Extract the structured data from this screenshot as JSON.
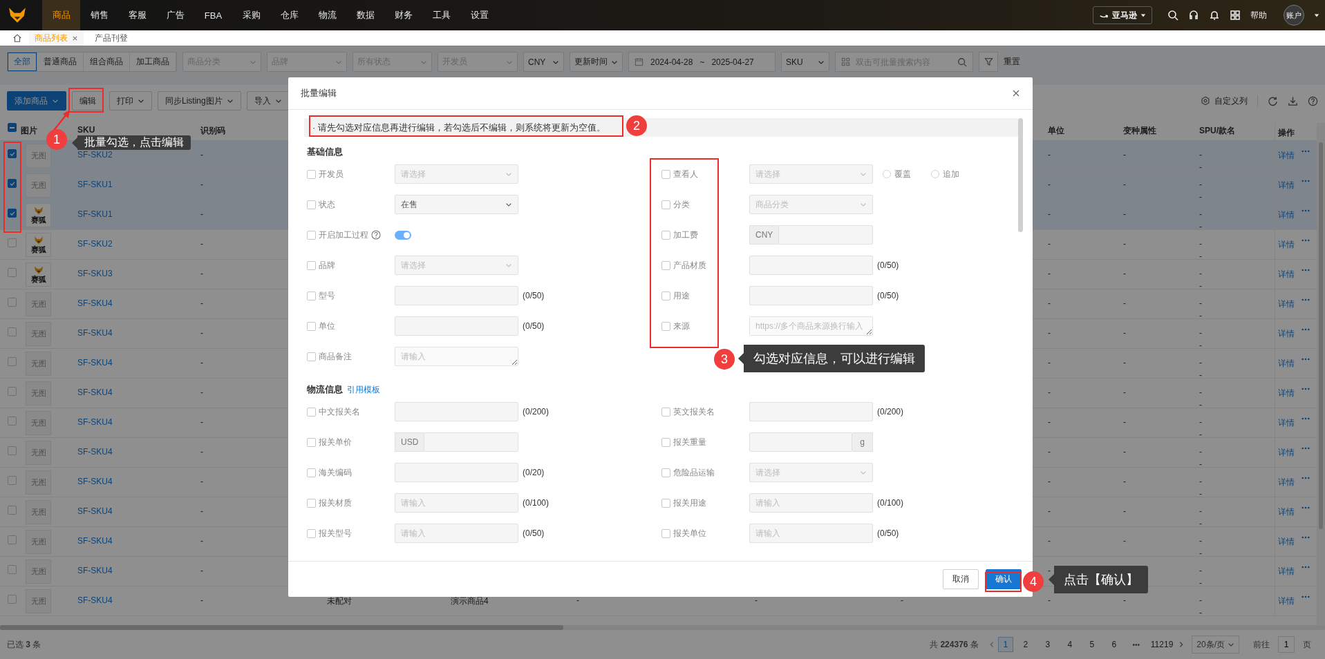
{
  "nav": {
    "items": [
      {
        "label": "商品",
        "selected": true
      },
      {
        "label": "销售",
        "selected": false
      },
      {
        "label": "客服",
        "selected": false
      },
      {
        "label": "广告",
        "selected": false
      },
      {
        "label": "FBA",
        "selected": false
      },
      {
        "label": "采购",
        "selected": false
      },
      {
        "label": "仓库",
        "selected": false
      },
      {
        "label": "物流",
        "selected": false
      },
      {
        "label": "数据",
        "selected": false
      },
      {
        "label": "财务",
        "selected": false
      },
      {
        "label": "工具",
        "selected": false
      },
      {
        "label": "设置",
        "selected": false
      }
    ],
    "platform": "亚马逊",
    "help": "帮助",
    "account": "账户"
  },
  "tabs": [
    {
      "label": "商品列表",
      "selected": true,
      "closable": true
    },
    {
      "label": "产品刊登",
      "selected": false,
      "closable": false
    }
  ],
  "filters": {
    "types": [
      {
        "label": "全部",
        "selected": true
      },
      {
        "label": "普通商品",
        "selected": false
      },
      {
        "label": "组合商品",
        "selected": false
      },
      {
        "label": "加工商品",
        "selected": false
      }
    ],
    "selects": [
      {
        "placeholder": "商品分类"
      },
      {
        "placeholder": "品牌"
      },
      {
        "placeholder": "所有状态"
      },
      {
        "placeholder": "开发员"
      },
      {
        "value": "CNY"
      },
      {
        "value": "更新时间"
      }
    ],
    "date_start": "2024-04-28",
    "date_sep": "~",
    "date_end": "2025-04-27",
    "search_by": "SKU",
    "search_placeholder": "双击可批量搜索内容",
    "reset": "重置"
  },
  "toolbar": {
    "buttons": [
      {
        "label": "添加商品",
        "kind": "primary",
        "caret": true
      },
      {
        "label": "编辑",
        "kind": "default",
        "caret": false
      },
      {
        "label": "打印",
        "kind": "default",
        "caret": true
      },
      {
        "label": "同步Listing图片",
        "kind": "default",
        "caret": true
      },
      {
        "label": "导入",
        "kind": "default",
        "caret": true
      }
    ],
    "columns_button": "自定义列"
  },
  "table": {
    "select_all_partial": true,
    "columns": [
      {
        "label": "图片"
      },
      {
        "label": "SKU"
      },
      {
        "label": "识别码"
      },
      {
        "label": "单位"
      },
      {
        "label": "变种属性"
      },
      {
        "label": "SPU/款名"
      },
      {
        "label": "操作"
      }
    ],
    "rows": [
      {
        "checked": true,
        "image": {
          "kind": "none",
          "text": "无图"
        },
        "sku": "SF-SKU2",
        "code": "-",
        "unit": "-",
        "variant": "-",
        "spu": [
          "-",
          "-"
        ],
        "action": "详情"
      },
      {
        "checked": true,
        "image": {
          "kind": "none",
          "text": "无图"
        },
        "sku": "SF-SKU1",
        "code": "-",
        "unit": "-",
        "variant": "-",
        "spu": [
          "-",
          "-"
        ],
        "action": "详情"
      },
      {
        "checked": true,
        "image": {
          "kind": "logo",
          "text": "赛狐"
        },
        "sku": "SF-SKU1",
        "code": "-",
        "unit": "-",
        "variant": "-",
        "spu": [
          "-",
          "-"
        ],
        "action": "详情"
      },
      {
        "checked": false,
        "image": {
          "kind": "logo",
          "text": "赛狐"
        },
        "sku": "SF-SKU2",
        "code": "-",
        "unit": "-",
        "variant": "-",
        "spu": [
          "-",
          "-"
        ],
        "action": "详情"
      },
      {
        "checked": false,
        "image": {
          "kind": "logo",
          "text": "赛狐"
        },
        "sku": "SF-SKU3",
        "code": "-",
        "unit": "-",
        "variant": "-",
        "spu": [
          "-",
          "-"
        ],
        "action": "详情"
      },
      {
        "checked": false,
        "image": {
          "kind": "none",
          "text": "无图"
        },
        "sku": "SF-SKU4",
        "code": "-",
        "unit": "-",
        "variant": "-",
        "spu": [
          "-",
          "-"
        ],
        "action": "详情"
      },
      {
        "checked": false,
        "image": {
          "kind": "none",
          "text": "无图"
        },
        "sku": "SF-SKU4",
        "code": "-",
        "unit": "-",
        "variant": "-",
        "spu": [
          "-",
          "-"
        ],
        "action": "详情"
      },
      {
        "checked": false,
        "image": {
          "kind": "none",
          "text": "无图"
        },
        "sku": "SF-SKU4",
        "code": "-",
        "unit": "-",
        "variant": "-",
        "spu": [
          "-",
          "-"
        ],
        "action": "详情"
      },
      {
        "checked": false,
        "image": {
          "kind": "none",
          "text": "无图"
        },
        "sku": "SF-SKU4",
        "code": "-",
        "unit": "-",
        "variant": "-",
        "spu": [
          "-",
          "-"
        ],
        "action": "详情"
      },
      {
        "checked": false,
        "image": {
          "kind": "none",
          "text": "无图"
        },
        "sku": "SF-SKU4",
        "code": "-",
        "unit": "-",
        "variant": "-",
        "spu": [
          "-",
          "-"
        ],
        "action": "详情"
      },
      {
        "checked": false,
        "image": {
          "kind": "none",
          "text": "无图"
        },
        "sku": "SF-SKU4",
        "code": "-",
        "unit": "-",
        "variant": "-",
        "spu": [
          "-",
          "-"
        ],
        "action": "详情"
      },
      {
        "checked": false,
        "image": {
          "kind": "none",
          "text": "无图"
        },
        "sku": "SF-SKU4",
        "code": "-",
        "unit": "-",
        "variant": "-",
        "spu": [
          "-",
          "-"
        ],
        "action": "详情"
      },
      {
        "checked": false,
        "image": {
          "kind": "none",
          "text": "无图"
        },
        "sku": "SF-SKU4",
        "code": "-",
        "unit": "-",
        "variant": "-",
        "spu": [
          "-",
          "-"
        ],
        "action": "详情"
      },
      {
        "checked": false,
        "image": {
          "kind": "none",
          "text": "无图"
        },
        "sku": "SF-SKU4",
        "code": "-",
        "unit": "-",
        "variant": "-",
        "spu": [
          "-",
          "-"
        ],
        "action": "详情"
      },
      {
        "checked": false,
        "image": {
          "kind": "none",
          "text": "无图"
        },
        "sku": "SF-SKU4",
        "code": "-",
        "unit": "-",
        "spu": [
          "-",
          "-"
        ],
        "action": "详情"
      },
      {
        "checked": false,
        "image": {
          "kind": "none",
          "text": "无图"
        },
        "sku": "SF-SKU4",
        "code": "-",
        "middle": [
          "未配对",
          "演示商品4",
          "-",
          "-",
          "-"
        ],
        "unit": "-",
        "variant": "-",
        "spu": [
          "-",
          "-"
        ],
        "action": "详情"
      }
    ]
  },
  "footer": {
    "selected": "已选 **3** 条",
    "total": "共 **224376** 条",
    "pages": [
      {
        "label": "1",
        "kind": "page",
        "selected": true
      },
      {
        "label": "2",
        "kind": "page",
        "selected": false
      },
      {
        "label": "3",
        "kind": "page",
        "selected": false
      },
      {
        "label": "4",
        "kind": "page",
        "selected": false
      },
      {
        "label": "5",
        "kind": "page",
        "selected": false
      },
      {
        "label": "6",
        "kind": "page",
        "selected": false
      },
      {
        "label": "•••",
        "kind": "ellipsis",
        "selected": false
      },
      {
        "label": "11219",
        "kind": "page",
        "selected": false
      }
    ],
    "page_size": "20条/页",
    "goto": "前往",
    "goto_value": "1",
    "page_unit": "页"
  },
  "modal": {
    "title": "批量编辑",
    "notice": "· 请先勾选对应信息再进行编辑，若勾选后不编辑，则系统将更新为空值。",
    "sections": [
      {
        "title": "基础信息",
        "left": [
          {
            "label": "开发员",
            "checked": false,
            "control": {
              "kind": "select",
              "placeholder": "请选择"
            }
          },
          {
            "label": "状态",
            "checked": false,
            "control": {
              "kind": "select",
              "value": "在售"
            }
          },
          {
            "label": "开启加工过程",
            "checked": false,
            "help": true,
            "control": {
              "kind": "toggle",
              "on": true
            }
          },
          {
            "label": "品牌",
            "checked": false,
            "control": {
              "kind": "select",
              "placeholder": "请选择"
            }
          },
          {
            "label": "型号",
            "checked": false,
            "control": {
              "kind": "input"
            },
            "counter": "(0/50)"
          },
          {
            "label": "单位",
            "checked": false,
            "control": {
              "kind": "input"
            },
            "counter": "(0/50)"
          },
          {
            "label": "商品备注",
            "checked": false,
            "control": {
              "kind": "textarea",
              "placeholder": "请输入"
            }
          }
        ],
        "right": [
          {
            "label": "查看人",
            "checked": false,
            "control": {
              "kind": "select",
              "placeholder": "请选择"
            },
            "options": [
              {
                "label": "覆盖",
                "selected": false
              },
              {
                "label": "追加",
                "selected": false
              }
            ]
          },
          {
            "label": "分类",
            "checked": false,
            "control": {
              "kind": "select",
              "placeholder": "商品分类"
            }
          },
          {
            "label": "加工费",
            "checked": false,
            "control": {
              "kind": "prefix",
              "addon": "CNY"
            }
          },
          {
            "label": "产品材质",
            "checked": false,
            "control": {
              "kind": "input"
            },
            "counter": "(0/50)"
          },
          {
            "label": "用途",
            "checked": false,
            "control": {
              "kind": "input"
            },
            "counter": "(0/50)"
          },
          {
            "label": "来源",
            "checked": false,
            "control": {
              "kind": "textarea",
              "placeholder": "https://多个商品来源换行输入"
            }
          }
        ]
      },
      {
        "title": "物流信息",
        "link": "引用模板",
        "left": [
          {
            "label": "中文报关名",
            "checked": false,
            "control": {
              "kind": "input"
            },
            "counter": "(0/200)"
          },
          {
            "label": "报关单价",
            "checked": false,
            "control": {
              "kind": "prefix",
              "addon": "USD"
            }
          },
          {
            "label": "海关编码",
            "checked": false,
            "control": {
              "kind": "input"
            },
            "counter": "(0/20)"
          },
          {
            "label": "报关材质",
            "checked": false,
            "control": {
              "kind": "input",
              "placeholder": "请输入"
            },
            "counter": "(0/100)"
          },
          {
            "label": "报关型号",
            "checked": false,
            "control": {
              "kind": "input",
              "placeholder": "请输入"
            },
            "counter": "(0/50)"
          }
        ],
        "right": [
          {
            "label": "英文报关名",
            "checked": false,
            "control": {
              "kind": "input"
            },
            "counter": "(0/200)"
          },
          {
            "label": "报关重量",
            "checked": false,
            "control": {
              "kind": "suffix",
              "addon": "g"
            }
          },
          {
            "label": "危险品运输",
            "checked": false,
            "control": {
              "kind": "select",
              "placeholder": "请选择"
            }
          },
          {
            "label": "报关用途",
            "checked": false,
            "control": {
              "kind": "input",
              "placeholder": "请输入"
            },
            "counter": "(0/100)"
          },
          {
            "label": "报关单位",
            "checked": false,
            "control": {
              "kind": "input",
              "placeholder": "请输入"
            },
            "counter": "(0/50)"
          }
        ]
      }
    ],
    "cancel": "取消",
    "confirm": "确认"
  },
  "annotations": [
    {
      "number": "1",
      "text": "批量勾选，点击编辑"
    },
    {
      "number": "2"
    },
    {
      "number": "3",
      "text": "勾选对应信息，可以进行编辑"
    },
    {
      "number": "4",
      "text": "点击【确认】"
    }
  ]
}
